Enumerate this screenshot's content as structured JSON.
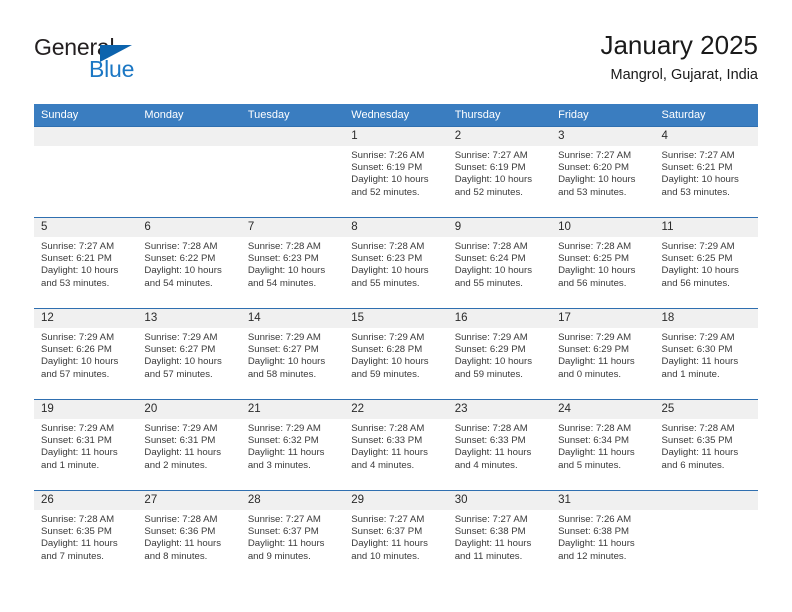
{
  "logo": {
    "word_general": "General",
    "word_blue": "Blue",
    "triangle_color": "#0c63ad",
    "blue_color": "#1b77c4"
  },
  "header": {
    "title": "January 2025",
    "location": "Mangrol, Gujarat, India"
  },
  "theme": {
    "header_bg": "#3a7dc0",
    "row_border": "#2f6fb0",
    "daynum_bg": "#f0f0f0"
  },
  "weekday_headers": [
    "Sunday",
    "Monday",
    "Tuesday",
    "Wednesday",
    "Thursday",
    "Friday",
    "Saturday"
  ],
  "weeks": [
    [
      {
        "day": "",
        "lines": []
      },
      {
        "day": "",
        "lines": []
      },
      {
        "day": "",
        "lines": []
      },
      {
        "day": "1",
        "lines": [
          "Sunrise: 7:26 AM",
          "Sunset: 6:19 PM",
          "Daylight: 10 hours",
          "and 52 minutes."
        ]
      },
      {
        "day": "2",
        "lines": [
          "Sunrise: 7:27 AM",
          "Sunset: 6:19 PM",
          "Daylight: 10 hours",
          "and 52 minutes."
        ]
      },
      {
        "day": "3",
        "lines": [
          "Sunrise: 7:27 AM",
          "Sunset: 6:20 PM",
          "Daylight: 10 hours",
          "and 53 minutes."
        ]
      },
      {
        "day": "4",
        "lines": [
          "Sunrise: 7:27 AM",
          "Sunset: 6:21 PM",
          "Daylight: 10 hours",
          "and 53 minutes."
        ]
      }
    ],
    [
      {
        "day": "5",
        "lines": [
          "Sunrise: 7:27 AM",
          "Sunset: 6:21 PM",
          "Daylight: 10 hours",
          "and 53 minutes."
        ]
      },
      {
        "day": "6",
        "lines": [
          "Sunrise: 7:28 AM",
          "Sunset: 6:22 PM",
          "Daylight: 10 hours",
          "and 54 minutes."
        ]
      },
      {
        "day": "7",
        "lines": [
          "Sunrise: 7:28 AM",
          "Sunset: 6:23 PM",
          "Daylight: 10 hours",
          "and 54 minutes."
        ]
      },
      {
        "day": "8",
        "lines": [
          "Sunrise: 7:28 AM",
          "Sunset: 6:23 PM",
          "Daylight: 10 hours",
          "and 55 minutes."
        ]
      },
      {
        "day": "9",
        "lines": [
          "Sunrise: 7:28 AM",
          "Sunset: 6:24 PM",
          "Daylight: 10 hours",
          "and 55 minutes."
        ]
      },
      {
        "day": "10",
        "lines": [
          "Sunrise: 7:28 AM",
          "Sunset: 6:25 PM",
          "Daylight: 10 hours",
          "and 56 minutes."
        ]
      },
      {
        "day": "11",
        "lines": [
          "Sunrise: 7:29 AM",
          "Sunset: 6:25 PM",
          "Daylight: 10 hours",
          "and 56 minutes."
        ]
      }
    ],
    [
      {
        "day": "12",
        "lines": [
          "Sunrise: 7:29 AM",
          "Sunset: 6:26 PM",
          "Daylight: 10 hours",
          "and 57 minutes."
        ]
      },
      {
        "day": "13",
        "lines": [
          "Sunrise: 7:29 AM",
          "Sunset: 6:27 PM",
          "Daylight: 10 hours",
          "and 57 minutes."
        ]
      },
      {
        "day": "14",
        "lines": [
          "Sunrise: 7:29 AM",
          "Sunset: 6:27 PM",
          "Daylight: 10 hours",
          "and 58 minutes."
        ]
      },
      {
        "day": "15",
        "lines": [
          "Sunrise: 7:29 AM",
          "Sunset: 6:28 PM",
          "Daylight: 10 hours",
          "and 59 minutes."
        ]
      },
      {
        "day": "16",
        "lines": [
          "Sunrise: 7:29 AM",
          "Sunset: 6:29 PM",
          "Daylight: 10 hours",
          "and 59 minutes."
        ]
      },
      {
        "day": "17",
        "lines": [
          "Sunrise: 7:29 AM",
          "Sunset: 6:29 PM",
          "Daylight: 11 hours",
          "and 0 minutes."
        ]
      },
      {
        "day": "18",
        "lines": [
          "Sunrise: 7:29 AM",
          "Sunset: 6:30 PM",
          "Daylight: 11 hours",
          "and 1 minute."
        ]
      }
    ],
    [
      {
        "day": "19",
        "lines": [
          "Sunrise: 7:29 AM",
          "Sunset: 6:31 PM",
          "Daylight: 11 hours",
          "and 1 minute."
        ]
      },
      {
        "day": "20",
        "lines": [
          "Sunrise: 7:29 AM",
          "Sunset: 6:31 PM",
          "Daylight: 11 hours",
          "and 2 minutes."
        ]
      },
      {
        "day": "21",
        "lines": [
          "Sunrise: 7:29 AM",
          "Sunset: 6:32 PM",
          "Daylight: 11 hours",
          "and 3 minutes."
        ]
      },
      {
        "day": "22",
        "lines": [
          "Sunrise: 7:28 AM",
          "Sunset: 6:33 PM",
          "Daylight: 11 hours",
          "and 4 minutes."
        ]
      },
      {
        "day": "23",
        "lines": [
          "Sunrise: 7:28 AM",
          "Sunset: 6:33 PM",
          "Daylight: 11 hours",
          "and 4 minutes."
        ]
      },
      {
        "day": "24",
        "lines": [
          "Sunrise: 7:28 AM",
          "Sunset: 6:34 PM",
          "Daylight: 11 hours",
          "and 5 minutes."
        ]
      },
      {
        "day": "25",
        "lines": [
          "Sunrise: 7:28 AM",
          "Sunset: 6:35 PM",
          "Daylight: 11 hours",
          "and 6 minutes."
        ]
      }
    ],
    [
      {
        "day": "26",
        "lines": [
          "Sunrise: 7:28 AM",
          "Sunset: 6:35 PM",
          "Daylight: 11 hours",
          "and 7 minutes."
        ]
      },
      {
        "day": "27",
        "lines": [
          "Sunrise: 7:28 AM",
          "Sunset: 6:36 PM",
          "Daylight: 11 hours",
          "and 8 minutes."
        ]
      },
      {
        "day": "28",
        "lines": [
          "Sunrise: 7:27 AM",
          "Sunset: 6:37 PM",
          "Daylight: 11 hours",
          "and 9 minutes."
        ]
      },
      {
        "day": "29",
        "lines": [
          "Sunrise: 7:27 AM",
          "Sunset: 6:37 PM",
          "Daylight: 11 hours",
          "and 10 minutes."
        ]
      },
      {
        "day": "30",
        "lines": [
          "Sunrise: 7:27 AM",
          "Sunset: 6:38 PM",
          "Daylight: 11 hours",
          "and 11 minutes."
        ]
      },
      {
        "day": "31",
        "lines": [
          "Sunrise: 7:26 AM",
          "Sunset: 6:38 PM",
          "Daylight: 11 hours",
          "and 12 minutes."
        ]
      },
      {
        "day": "",
        "lines": []
      }
    ]
  ]
}
